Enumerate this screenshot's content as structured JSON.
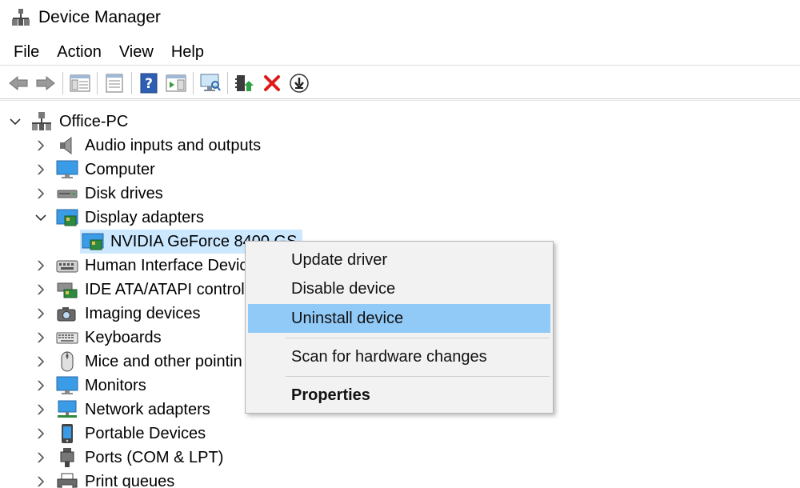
{
  "window": {
    "title": "Device Manager"
  },
  "menu": [
    "File",
    "Action",
    "View",
    "Help"
  ],
  "toolbar": [
    "back-icon",
    "forward-icon",
    "console-tree-icon",
    "properties-icon",
    "help-icon",
    "action-pane-icon",
    "scan-hardware-icon",
    "update-driver-icon",
    "uninstall-icon",
    "install-driver-icon"
  ],
  "tree": {
    "root": "Office-PC",
    "items": [
      {
        "label": "Audio inputs and outputs",
        "icon": "speaker-icon",
        "expanded": false
      },
      {
        "label": "Computer",
        "icon": "monitor-icon",
        "expanded": false
      },
      {
        "label": "Disk drives",
        "icon": "disk-drive-icon",
        "expanded": false
      },
      {
        "label": "Display adapters",
        "icon": "display-adapter-icon",
        "expanded": true
      },
      {
        "label": "NVIDIA GeForce 8400 GS",
        "icon": "display-adapter-icon",
        "child": true,
        "selected": true
      },
      {
        "label": "Human Interface Devic",
        "icon": "hid-icon",
        "expanded": false
      },
      {
        "label": "IDE ATA/ATAPI control",
        "icon": "ide-controller-icon",
        "expanded": false
      },
      {
        "label": "Imaging devices",
        "icon": "camera-icon",
        "expanded": false
      },
      {
        "label": "Keyboards",
        "icon": "keyboard-icon",
        "expanded": false
      },
      {
        "label": "Mice and other pointin",
        "icon": "mouse-icon",
        "expanded": false
      },
      {
        "label": "Monitors",
        "icon": "monitor-icon",
        "expanded": false
      },
      {
        "label": "Network adapters",
        "icon": "network-adapter-icon",
        "expanded": false
      },
      {
        "label": "Portable Devices",
        "icon": "portable-device-icon",
        "expanded": false
      },
      {
        "label": "Ports (COM & LPT)",
        "icon": "port-icon",
        "expanded": false
      },
      {
        "label": "Print queues",
        "icon": "printer-icon",
        "expanded": false
      }
    ]
  },
  "context_menu": {
    "update": "Update driver",
    "disable": "Disable device",
    "uninstall": "Uninstall device",
    "scan": "Scan for hardware changes",
    "properties": "Properties"
  }
}
